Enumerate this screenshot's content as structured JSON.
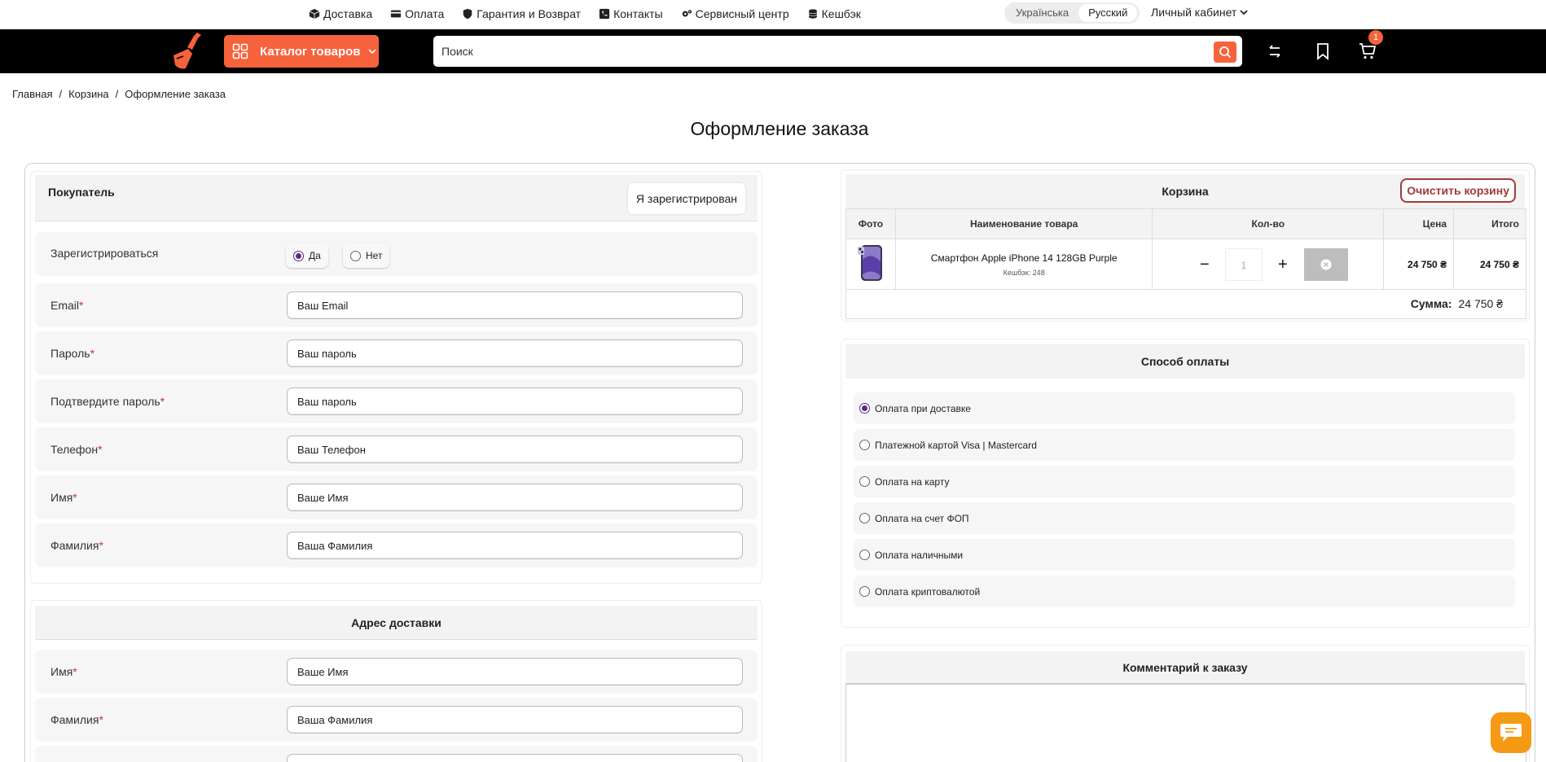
{
  "top_links": [
    {
      "label": "Доставка",
      "icon": "box-icon"
    },
    {
      "label": "Оплата",
      "icon": "card-icon"
    },
    {
      "label": "Гарантия и Возврат",
      "icon": "shield-icon"
    },
    {
      "label": "Контакты",
      "icon": "phone-icon"
    },
    {
      "label": "Сервисный центр",
      "icon": "gears-icon"
    },
    {
      "label": "Кешбэк",
      "icon": "coins-icon"
    }
  ],
  "language": {
    "options": [
      "Українська",
      "Русский"
    ],
    "active": "Русский"
  },
  "cabinet_label": "Личный кабинет",
  "header": {
    "catalog_label": "Каталог товаров",
    "search_placeholder": "Поиск",
    "cart_count": "1",
    "accent": "#f5623c"
  },
  "breadcrumb": [
    "Главная",
    "Корзина",
    "Оформление заказа"
  ],
  "page_title": "Оформление заказа",
  "buyer": {
    "title": "Покупатель",
    "registered_button": "Я зарегистрирован",
    "register_label": "Зарегистрироваться",
    "register_yes": "Да",
    "register_no": "Нет",
    "fields": [
      {
        "label": "Email",
        "required": "*",
        "placeholder": "Ваш Email"
      },
      {
        "label": "Пароль",
        "required": "*",
        "placeholder": "Ваш пароль"
      },
      {
        "label": "Подтвердите пароль",
        "required": "*",
        "placeholder": "Ваш пароль"
      },
      {
        "label": "Телефон",
        "required": "*",
        "placeholder": "Ваш Телефон"
      },
      {
        "label": "Имя",
        "required": "*",
        "placeholder": "Ваше Имя"
      },
      {
        "label": "Фамилия",
        "required": "*",
        "placeholder": "Ваша Фамилия"
      }
    ]
  },
  "delivery": {
    "title": "Адрес доставки",
    "fields": [
      {
        "label": "Имя",
        "required": "*",
        "placeholder": "Ваше Имя"
      },
      {
        "label": "Фамилия",
        "required": "*",
        "placeholder": "Ваша Фамилия"
      }
    ]
  },
  "cart": {
    "title": "Корзина",
    "clear_button": "Очистить корзину",
    "columns": [
      "Фото",
      "Наименование товара",
      "Кол-во",
      "Цена",
      "Итого"
    ],
    "item": {
      "name": "Смартфон Apple iPhone 14 128GB Purple",
      "cashback": "Кешбэк: 248",
      "qty": "1",
      "price": "24 750 ₴",
      "total": "24 750 ₴"
    },
    "sum_label": "Сумма:",
    "sum_value": "24 750 ₴"
  },
  "payment": {
    "title": "Способ оплаты",
    "options": [
      "Оплата при доставке",
      "Платежной картой Visa | Mastercard",
      "Оплата на карту",
      "Оплата на счет ФОП",
      "Оплата наличными",
      "Оплата криптовалютой"
    ],
    "selected": "Оплата при доставке"
  },
  "comment": {
    "title": "Комментарий к заказу"
  }
}
